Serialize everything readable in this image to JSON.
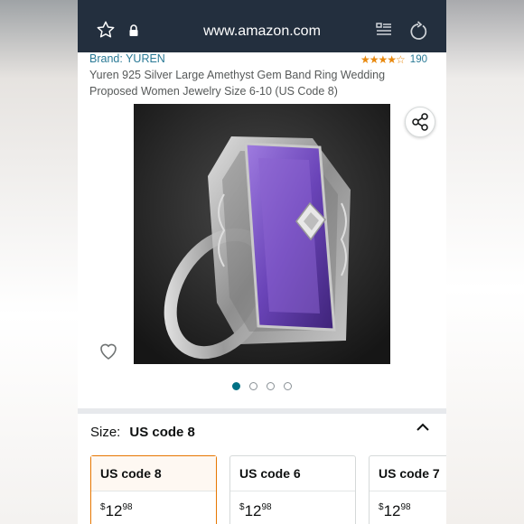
{
  "browser": {
    "url": "www.amazon.com",
    "icons": [
      "star-icon",
      "lock-icon",
      "reader-icon",
      "reload-icon"
    ]
  },
  "product": {
    "brand": "Brand: YUREN",
    "rating": 4.5,
    "rating_count": "190",
    "title": "Yuren 925 Silver Large Amethyst Gem Band Ring Wedding Proposed Women Jewelry Size 6-10 (US Code 8)",
    "image_count": 4,
    "image_selected_index": 0
  },
  "size": {
    "label": "Size:",
    "selected": "US code 8",
    "options": [
      {
        "name": "US code 8",
        "currency": "$",
        "whole": "12",
        "fraction": "98"
      },
      {
        "name": "US code 6",
        "currency": "$",
        "whole": "12",
        "fraction": "98"
      },
      {
        "name": "US code 7",
        "currency": "$",
        "whole": "12",
        "fraction": "98"
      }
    ]
  },
  "colors": {
    "url_bar": "#232f3e",
    "link": "#2a7a96",
    "star": "#e8890f",
    "selected_border": "#e77600"
  }
}
